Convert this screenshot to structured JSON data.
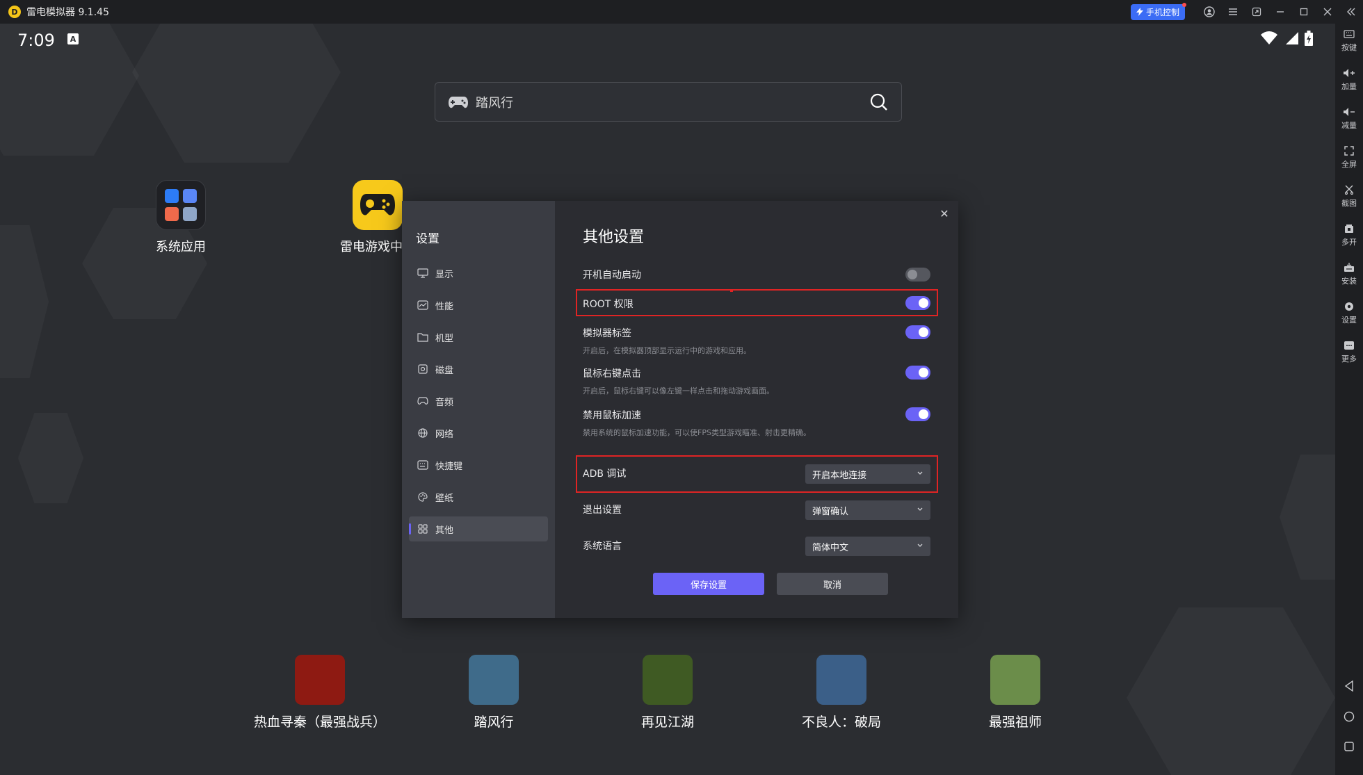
{
  "window": {
    "logo_letter": "D",
    "title": "雷电模拟器 9.1.45",
    "phone_control_label": "手机控制",
    "controls": [
      "account-icon",
      "menu-icon",
      "restore-small-icon",
      "minimize-icon",
      "maximize-icon",
      "close-icon",
      "collapse-icon"
    ]
  },
  "status_bar": {
    "time": "7:09",
    "notification_glyph": "A"
  },
  "search": {
    "text": "踏风行"
  },
  "desktop_apps": [
    {
      "label": "系统应用"
    },
    {
      "label": "雷电游戏中心"
    }
  ],
  "dock": [
    {
      "label": "热血寻秦（最强战兵）",
      "color": "#8e1a12"
    },
    {
      "label": "踏风行",
      "color": "#3f6b8a"
    },
    {
      "label": "再见江湖",
      "color": "#3f5a23"
    },
    {
      "label": "不良人：破局",
      "color": "#3b5f88"
    },
    {
      "label": "最强祖师",
      "color": "#6b8d4a"
    }
  ],
  "dialog": {
    "sidebar_title": "设置",
    "nav": [
      {
        "label": "显示",
        "icon": "monitor-icon"
      },
      {
        "label": "性能",
        "icon": "performance-icon"
      },
      {
        "label": "机型",
        "icon": "folder-icon"
      },
      {
        "label": "磁盘",
        "icon": "disk-icon"
      },
      {
        "label": "音频",
        "icon": "gamepad-icon"
      },
      {
        "label": "网络",
        "icon": "globe-icon"
      },
      {
        "label": "快捷键",
        "icon": "keyboard-icon"
      },
      {
        "label": "壁纸",
        "icon": "palette-icon"
      },
      {
        "label": "其他",
        "icon": "grid-icon"
      }
    ],
    "active_nav": "其他",
    "title": "其他设置",
    "close_glyph": "✕",
    "settings": {
      "autostart": {
        "label": "开机自动启动",
        "on": false
      },
      "root": {
        "label": "ROOT 权限",
        "on": true
      },
      "emulator_tag": {
        "label": "模拟器标签",
        "desc": "开启后，在模拟器顶部显示运行中的游戏和应用。",
        "on": true
      },
      "right_click": {
        "label": "鼠标右键点击",
        "desc": "开启后，鼠标右键可以像左键一样点击和拖动游戏画面。",
        "on": true
      },
      "mouse_accel": {
        "label": "禁用鼠标加速",
        "desc": "禁用系统的鼠标加速功能，可以使FPS类型游戏瞄准、射击更精确。",
        "on": true
      },
      "adb": {
        "label": "ADB 调试",
        "value": "开启本地连接"
      },
      "exit": {
        "label": "退出设置",
        "value": "弹窗确认"
      },
      "language": {
        "label": "系统语言",
        "value": "简体中文"
      }
    },
    "save_label": "保存设置",
    "cancel_label": "取消",
    "highlight_color": "#e02424",
    "accent_color": "#6b63f6"
  },
  "right_toolbar": [
    {
      "label": "按键",
      "icon": "keyboard-icon"
    },
    {
      "label": "加量",
      "icon": "volume-up-icon"
    },
    {
      "label": "减量",
      "icon": "volume-down-icon"
    },
    {
      "label": "全屏",
      "icon": "fullscreen-icon"
    },
    {
      "label": "截图",
      "icon": "scissors-icon"
    },
    {
      "label": "多开",
      "icon": "multi-instance-icon"
    },
    {
      "label": "安装",
      "icon": "install-icon"
    },
    {
      "label": "设置",
      "icon": "gear-icon"
    },
    {
      "label": "更多",
      "icon": "more-icon"
    }
  ]
}
